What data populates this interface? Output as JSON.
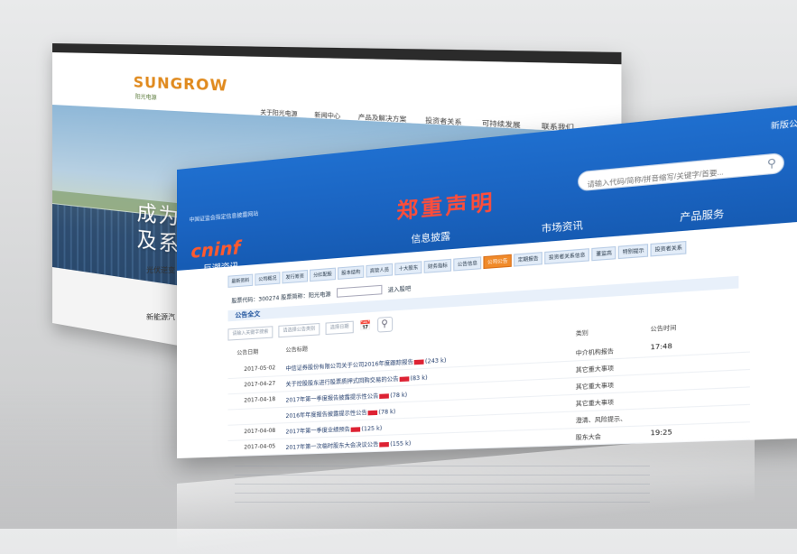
{
  "back_site": {
    "logo": "SUNGROW",
    "logo_sub": "阳光电源",
    "nav": [
      "关于阳光电源",
      "新闻中心",
      "产品及解决方案",
      "投资者关系",
      "可持续发展",
      "联系我们"
    ],
    "hero_line1": "成为全球一流逆变设备",
    "hero_line2": "及系统解决方案供应商",
    "side_text1": "光伏逆变",
    "side_text2": "新能源汽"
  },
  "front_site": {
    "site_note": "中国证监会指定信息披露网站",
    "login": "新版公测",
    "title": "郑重声明",
    "search_placeholder": "请输入代码/简称/拼音缩写/关键字/首要...",
    "logo": "cninf",
    "logo_sub": "巨潮资讯",
    "nav": [
      "信息披露",
      "市场资讯",
      "产品服务"
    ],
    "subnav": [
      "最新资料",
      "公司概况",
      "发行筹资",
      "分红配股",
      "股本结构",
      "高管人员",
      "十大股东",
      "财务指标",
      "公告信息",
      "公司公告",
      "定期报告",
      "投资者关系信息",
      "董监高",
      "特别提示",
      "投资者关系"
    ],
    "subnav_active_index": 9,
    "code_label": "股票代码：300274 股票简称：阳光电源",
    "code_button": "进入股吧",
    "section_title": "公告全文",
    "filter_keyword": "请输入关键字搜索",
    "filter_category": "请选择公告类别",
    "filter_date": "选择日期",
    "header": {
      "date": "公告日期",
      "title": "公告标题",
      "category": "类别",
      "time": "公告时间"
    },
    "rows": [
      {
        "date": "2017-05-02",
        "title": "中信证券股份有限公司关于公司2016年度跟踪报告",
        "size": "(243 k)",
        "category": "中介机构报告",
        "time": "17:48"
      },
      {
        "date": "2017-04-27",
        "title": "关于控股股东进行股票质押式回购交易的公告",
        "size": "(83 k)",
        "category": "其它重大事项",
        "time": ""
      },
      {
        "date": "2017-04-18",
        "title": "2017年第一季度报告披露提示性公告",
        "size": "(78 k)",
        "category": "其它重大事项",
        "time": ""
      },
      {
        "date": "",
        "title": "2016年年度报告披露提示性公告",
        "size": "(78 k)",
        "category": "其它重大事项",
        "time": ""
      },
      {
        "date": "2017-04-08",
        "title": "2017年第一季度业绩预告",
        "size": "(125 k)",
        "category": "澄清、风险提示、",
        "time": ""
      },
      {
        "date": "2017-04-05",
        "title": "2017年第一次临时股东大会决议公告",
        "size": "(155 k)",
        "category": "股东大会",
        "time": "19:25"
      }
    ]
  }
}
